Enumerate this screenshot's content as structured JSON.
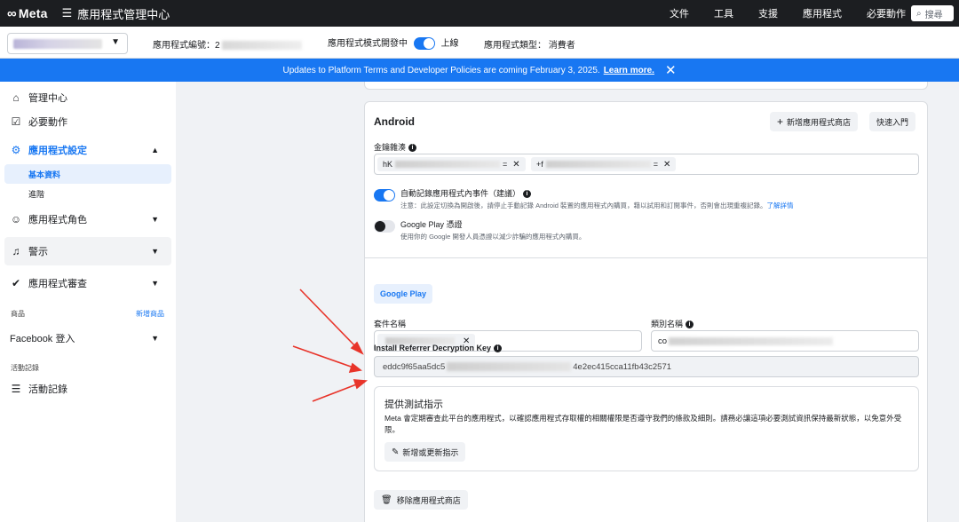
{
  "topbar": {
    "logo": "Meta",
    "app_title": "應用程式管理中心",
    "menu": [
      "文件",
      "工具",
      "支援",
      "應用程式",
      "必要動作"
    ],
    "search_placeholder": "搜尋"
  },
  "subbar": {
    "app_id_label": "應用程式編號：2",
    "mode_label": "應用程式模式開發中",
    "mode_value": "上線",
    "type_label": "應用程式類型：",
    "type_value": "消費者"
  },
  "banner": {
    "text": "Updates to Platform Terms and Developer Policies are coming February 3, 2025.",
    "link": "Learn more."
  },
  "sidebar": {
    "dashboard": "管理中心",
    "required_actions": "必要動作",
    "app_settings": "應用程式設定",
    "basic": "基本資料",
    "advanced": "進階",
    "app_roles": "應用程式角色",
    "alerts": "警示",
    "app_review": "應用程式審查",
    "products_label": "商品",
    "add_product": "新增商品",
    "facebook_login": "Facebook 登入",
    "activity_label": "活動記錄",
    "activity_log": "活動記錄"
  },
  "android": {
    "title": "Android",
    "add_store_button": "新增應用程式商店",
    "quick_start_button": "快速入門",
    "key_hashes_label": "金鑰雜湊",
    "key_hash_1_prefix": "hK",
    "key_hash_1_suffix": "=",
    "key_hash_2_prefix": "+f",
    "key_hash_2_suffix": "=",
    "auto_log_title": "自動記錄應用程式內事件（建議）",
    "auto_log_desc": "注意：此設定切換為開啟後，請停止手動記錄 Android 裝置的應用程式內購買，藉以試用和訂閱事件，否則會出現重複記錄。",
    "learn_more": "了解詳情",
    "gp_billing_title": "Google Play 憑證",
    "gp_billing_desc": "使用你的 Google 開發人員憑證以減少詐騙的應用程式內購買。",
    "google_play_tab": "Google Play",
    "package_name_label": "套件名稱",
    "class_name_label": "類別名稱",
    "class_name_prefix": "co",
    "referrer_key_label": "Install Referrer Decryption Key",
    "referrer_key_start": "eddc9f65aa5dc5",
    "referrer_key_end": "4e2ec415cca11fb43c2571",
    "test_title": "提供測試指示",
    "test_desc": "Meta 會定期審查此平台的應用程式，以確認應用程式存取權的相關權限是否遵守我們的條款及細則。請務必讓這項必要測試資訊保持最新狀態，以免意外受限。",
    "add_update_button": "新增或更新指示",
    "remove_store_button": "移除應用程式商店"
  }
}
